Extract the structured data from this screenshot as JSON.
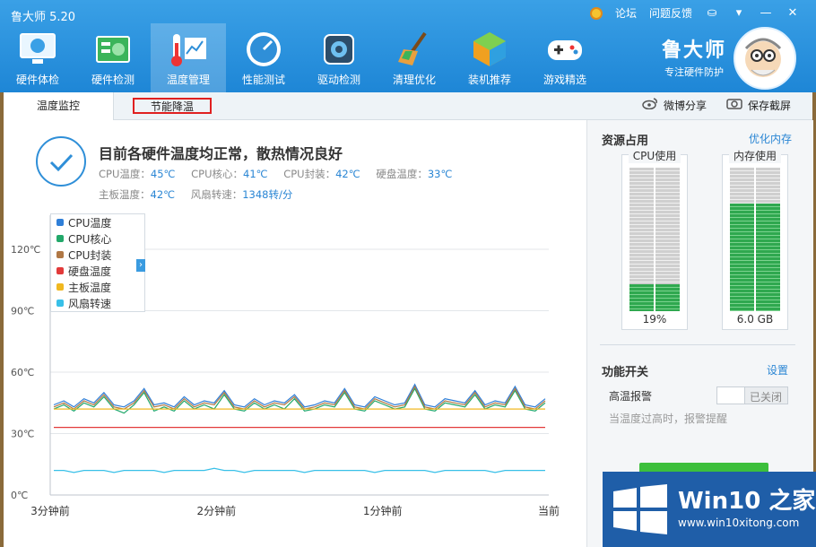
{
  "app": {
    "title": "鲁大师 5.20"
  },
  "top_links": {
    "forum": "论坛",
    "feedback": "问题反馈"
  },
  "window_controls": {
    "skin": "⛀",
    "menu": "▾",
    "minimize": "—",
    "close": "✕"
  },
  "nav": [
    {
      "label": "硬件体检",
      "icon": "monitor-icon"
    },
    {
      "label": "硬件检测",
      "icon": "board-icon"
    },
    {
      "label": "温度管理",
      "icon": "thermometer-icon"
    },
    {
      "label": "性能测试",
      "icon": "gauge-icon"
    },
    {
      "label": "驱动检测",
      "icon": "gear-icon"
    },
    {
      "label": "清理优化",
      "icon": "broom-icon"
    },
    {
      "label": "装机推荐",
      "icon": "cube-icon"
    },
    {
      "label": "游戏精选",
      "icon": "gamepad-icon"
    }
  ],
  "brand": {
    "name": "鲁大师",
    "slogan": "专注硬件防护"
  },
  "tabs": {
    "monitor": "温度监控",
    "cooling": "节能降温"
  },
  "share": {
    "weibo": "微博分享",
    "screenshot": "保存截屏"
  },
  "status": {
    "headline": "目前各硬件温度均正常，散热情况良好",
    "cpu_temp_k": "CPU温度：",
    "cpu_temp_v": "45℃",
    "cpu_core_k": "CPU核心：",
    "cpu_core_v": "41℃",
    "cpu_pkg_k": "CPU封装：",
    "cpu_pkg_v": "42℃",
    "disk_k": "硬盘温度：",
    "disk_v": "33℃",
    "board_k": "主板温度：",
    "board_v": "42℃",
    "fan_k": "风扇转速：",
    "fan_v": "1348转/分"
  },
  "legend": [
    "CPU温度",
    "CPU核心",
    "CPU封装",
    "硬盘温度",
    "主板温度",
    "风扇转速"
  ],
  "chart_data": {
    "type": "line",
    "y_ticks": [
      "120℃",
      "90℃",
      "60℃",
      "30℃",
      "0℃"
    ],
    "ylim": [
      0,
      120
    ],
    "x_ticks": [
      "3分钟前",
      "2分钟前",
      "1分钟前",
      "当前"
    ],
    "series": [
      {
        "name": "CPU温度",
        "color": "#2f7fd8",
        "values": [
          44,
          46,
          43,
          47,
          45,
          50,
          44,
          43,
          46,
          52,
          44,
          45,
          43,
          48,
          44,
          46,
          45,
          51,
          44,
          43,
          47,
          44,
          46,
          45,
          49,
          43,
          44,
          46,
          45,
          52,
          44,
          43,
          48,
          46,
          44,
          45,
          54,
          44,
          43,
          47,
          46,
          45,
          51,
          44,
          46,
          45,
          53,
          44,
          43,
          47
        ]
      },
      {
        "name": "CPU核心",
        "color": "#22a86a",
        "values": [
          42,
          44,
          41,
          45,
          43,
          48,
          42,
          40,
          44,
          50,
          41,
          43,
          41,
          46,
          42,
          44,
          42,
          49,
          42,
          41,
          45,
          42,
          44,
          42,
          47,
          41,
          42,
          44,
          43,
          50,
          42,
          41,
          46,
          44,
          42,
          43,
          52,
          42,
          41,
          45,
          44,
          43,
          49,
          42,
          44,
          43,
          51,
          42,
          41,
          45
        ]
      },
      {
        "name": "CPU封装",
        "color": "#b07845",
        "values": [
          43,
          45,
          42,
          46,
          44,
          49,
          43,
          42,
          45,
          51,
          43,
          44,
          42,
          47,
          43,
          45,
          44,
          50,
          43,
          42,
          46,
          43,
          45,
          44,
          48,
          42,
          43,
          45,
          44,
          51,
          43,
          42,
          47,
          45,
          43,
          44,
          53,
          43,
          42,
          46,
          45,
          44,
          50,
          43,
          45,
          44,
          52,
          43,
          42,
          46
        ]
      },
      {
        "name": "硬盘温度",
        "color": "#e23a3a",
        "values": [
          33,
          33,
          33,
          33,
          33,
          33,
          33,
          33,
          33,
          33,
          33,
          33,
          33,
          33,
          33,
          33,
          33,
          33,
          33,
          33,
          33,
          33,
          33,
          33,
          33,
          33,
          33,
          33,
          33,
          33,
          33,
          33,
          33,
          33,
          33,
          33,
          33,
          33,
          33,
          33,
          33,
          33,
          33,
          33,
          33,
          33,
          33,
          33,
          33,
          33
        ]
      },
      {
        "name": "主板温度",
        "color": "#f0b820",
        "values": [
          42,
          42,
          42,
          42,
          42,
          42,
          42,
          42,
          42,
          42,
          42,
          42,
          42,
          42,
          42,
          42,
          42,
          42,
          42,
          42,
          42,
          42,
          42,
          42,
          42,
          42,
          42,
          42,
          42,
          42,
          42,
          42,
          42,
          42,
          42,
          42,
          42,
          42,
          42,
          42,
          42,
          42,
          42,
          42,
          42,
          42,
          42,
          42,
          42,
          42
        ]
      },
      {
        "name": "风扇转速",
        "color": "#38c0e8",
        "values": [
          12,
          12,
          11,
          12,
          12,
          12,
          11,
          12,
          12,
          12,
          12,
          11,
          12,
          12,
          12,
          12,
          13,
          12,
          12,
          11,
          12,
          12,
          12,
          12,
          12,
          11,
          12,
          12,
          12,
          12,
          12,
          12,
          11,
          12,
          12,
          12,
          12,
          12,
          11,
          12,
          12,
          12,
          12,
          12,
          11,
          12,
          12,
          12,
          12,
          12
        ]
      }
    ]
  },
  "sidebar": {
    "resources_title": "资源占用",
    "optimize_memory": "优化内存",
    "cpu_label": "CPU使用",
    "cpu_value": "19%",
    "cpu_fraction": 0.19,
    "mem_label": "内存使用",
    "mem_value": "6.0 GB",
    "mem_fraction": 0.75,
    "features_title": "功能开关",
    "settings": "设置",
    "alarm_label": "高温报警",
    "alarm_state": "已关闭",
    "alarm_desc": "当温度过高时，报警提醒"
  },
  "watermark": {
    "text": "Win10 之家",
    "url": "www.win10xitong.com"
  }
}
